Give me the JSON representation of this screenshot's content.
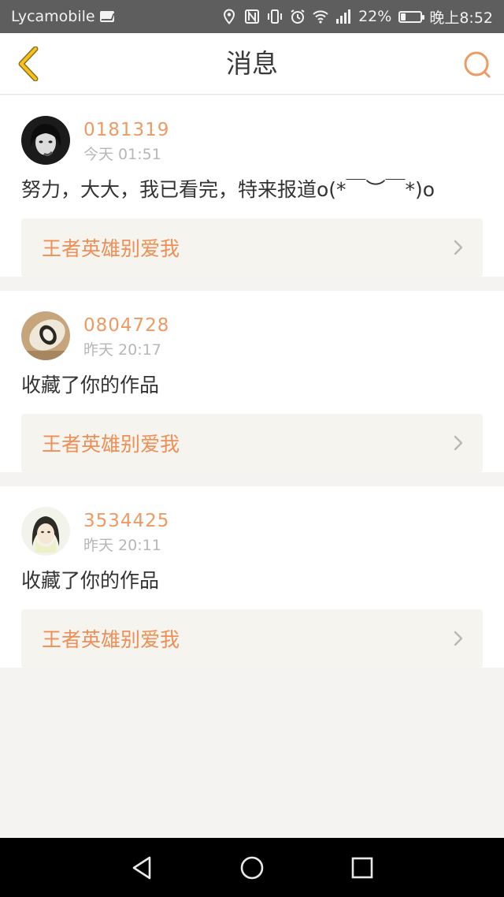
{
  "status": {
    "carrier": "Lycamobile",
    "battery": "22%",
    "battery_level": 0.22,
    "clock": "晚上8:52"
  },
  "nav": {
    "title": "消息"
  },
  "messages": [
    {
      "username": "0181319",
      "time": "今天 01:51",
      "text": "努力，大大，我已看完，特来报道o(*￣︶￣*)o",
      "link": "王者英雄别爱我"
    },
    {
      "username": "0804728",
      "time": "昨天 20:17",
      "text": "收藏了你的作品",
      "link": "王者英雄别爱我"
    },
    {
      "username": "3534425",
      "time": "昨天 20:11",
      "text": "收藏了你的作品",
      "link": "王者英雄别爱我"
    }
  ],
  "colors": {
    "accent": "#ed9a63",
    "link_bg": "#f6f4ef",
    "status_bar": "#5e5e5e"
  }
}
